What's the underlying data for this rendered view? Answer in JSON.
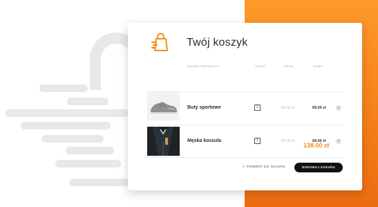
{
  "cart": {
    "title": "Twój koszyk",
    "columns": {
      "product": "NAZWA PRODUKTU",
      "qty": "ILOŚĆ",
      "price": "CENA",
      "sum": "SUMA"
    },
    "items": [
      {
        "name": "Buty sportowe",
        "qty": "1",
        "price": "69.00 zł",
        "sum": "69.00 zł",
        "remove": "✕"
      },
      {
        "name": "Męska koszula",
        "qty": "1",
        "price": "69.00 zł",
        "sum": "69.00 zł",
        "remove": "✕"
      }
    ],
    "total": "138.00 zł",
    "back_label": "POWRÓT DO SKLEPU",
    "back_chevron": "<",
    "checkout_label": "DOKONAJ ZAKUPU"
  },
  "colors": {
    "accent": "#f58a1f",
    "button": "#111111",
    "background_orange": "#f7831c"
  },
  "icons": {
    "bag": "shopping-bag-icon",
    "remove": "close-icon"
  }
}
